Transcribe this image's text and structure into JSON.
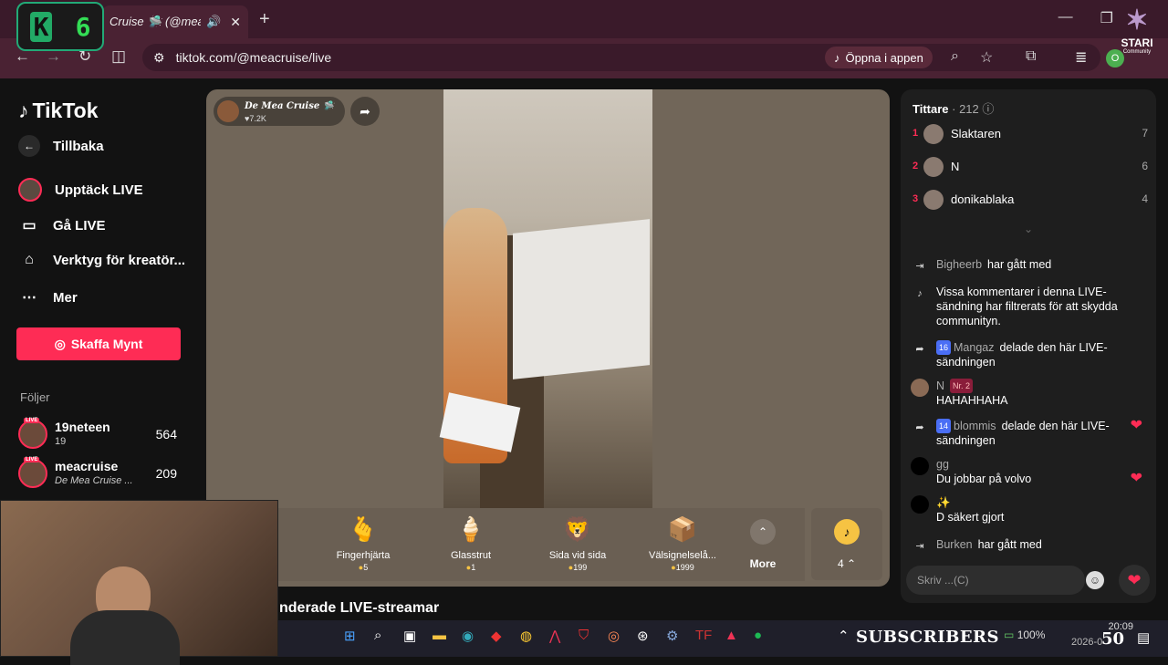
{
  "browser": {
    "tab_title": "Cruise 🛸 (@mea",
    "url": "tiktok.com/@meacruise/live",
    "open_in_app": "Öppna i appen",
    "profile_initial": "O"
  },
  "overlay": {
    "k_letter": "K",
    "k_number": "6",
    "stari_label": "STARI",
    "stari_sub": "Community",
    "subscribers_label": "SUBSCRIBERS",
    "subscribers_count": "50"
  },
  "sidebar": {
    "logo": "TikTok",
    "back": "Tillbaka",
    "items": [
      {
        "label": "Upptäck LIVE",
        "icon": "live-avatar-icon"
      },
      {
        "label": "Gå LIVE",
        "icon": "camera-icon"
      },
      {
        "label": "Verktyg för kreatör...",
        "icon": "creator-tools-icon"
      },
      {
        "label": "Mer",
        "icon": "more-icon"
      }
    ],
    "coins_button": "Skaffa Mynt",
    "follows_title": "Följer",
    "follows": [
      {
        "name": "19neteen",
        "sub": "19",
        "count": "564",
        "live": "LIVE"
      },
      {
        "name": "meacruise",
        "sub": "De Mea Cruise ...",
        "count": "209",
        "live": "LIVE"
      }
    ]
  },
  "stream": {
    "host_name": "De Mea Cruise 🛸",
    "host_likes": "♥7.2K",
    "gifts": [
      {
        "name": "Fingerhjärta",
        "price": "5",
        "icon": "🫰"
      },
      {
        "name": "Glasstrut",
        "price": "1",
        "icon": "🍦"
      },
      {
        "name": "Sida vid sida",
        "price": "199",
        "icon": "🦁"
      },
      {
        "name": "Välsignelselå...",
        "price": "1999",
        "icon": "📦"
      }
    ],
    "more_label": "More",
    "coin_count": "4"
  },
  "recommended_title": "nderade LIVE-streamar",
  "chat": {
    "viewers_label": "Tittare",
    "viewers_count": "· 212",
    "top_viewers": [
      {
        "rank": "1",
        "name": "Slaktaren",
        "score": "7"
      },
      {
        "rank": "2",
        "name": "N",
        "score": "6"
      },
      {
        "rank": "3",
        "name": "donikablaka",
        "score": "4"
      }
    ],
    "messages": [
      {
        "user": "Bigheerb",
        "text": "har gått med"
      },
      {
        "user": "",
        "text": "Vissa kommentarer i denna LIVE-sändning har filtrerats för att skydda communityn."
      },
      {
        "user": "Mangaz",
        "badge": "16",
        "text": "delade den här LIVE-sändningen"
      },
      {
        "user": "N",
        "badge": "Nr. 2",
        "text": "HAHAHHAHA"
      },
      {
        "user": "blommis",
        "badge": "14",
        "text": "delade den här LIVE-sändningen"
      },
      {
        "user": "gg",
        "text": "Du jobbar på volvo"
      },
      {
        "user": "✨",
        "text": "D säkert gjort"
      },
      {
        "user": "Burken",
        "text": "har gått med"
      }
    ],
    "input_placeholder": "Skriv ...(C)"
  },
  "taskbar": {
    "battery": "100%",
    "time": "20:09",
    "date": "2026-0"
  },
  "colors": {
    "accent": "#fe2c55",
    "chrome": "#4a2233",
    "stream_bg": "#716659"
  }
}
